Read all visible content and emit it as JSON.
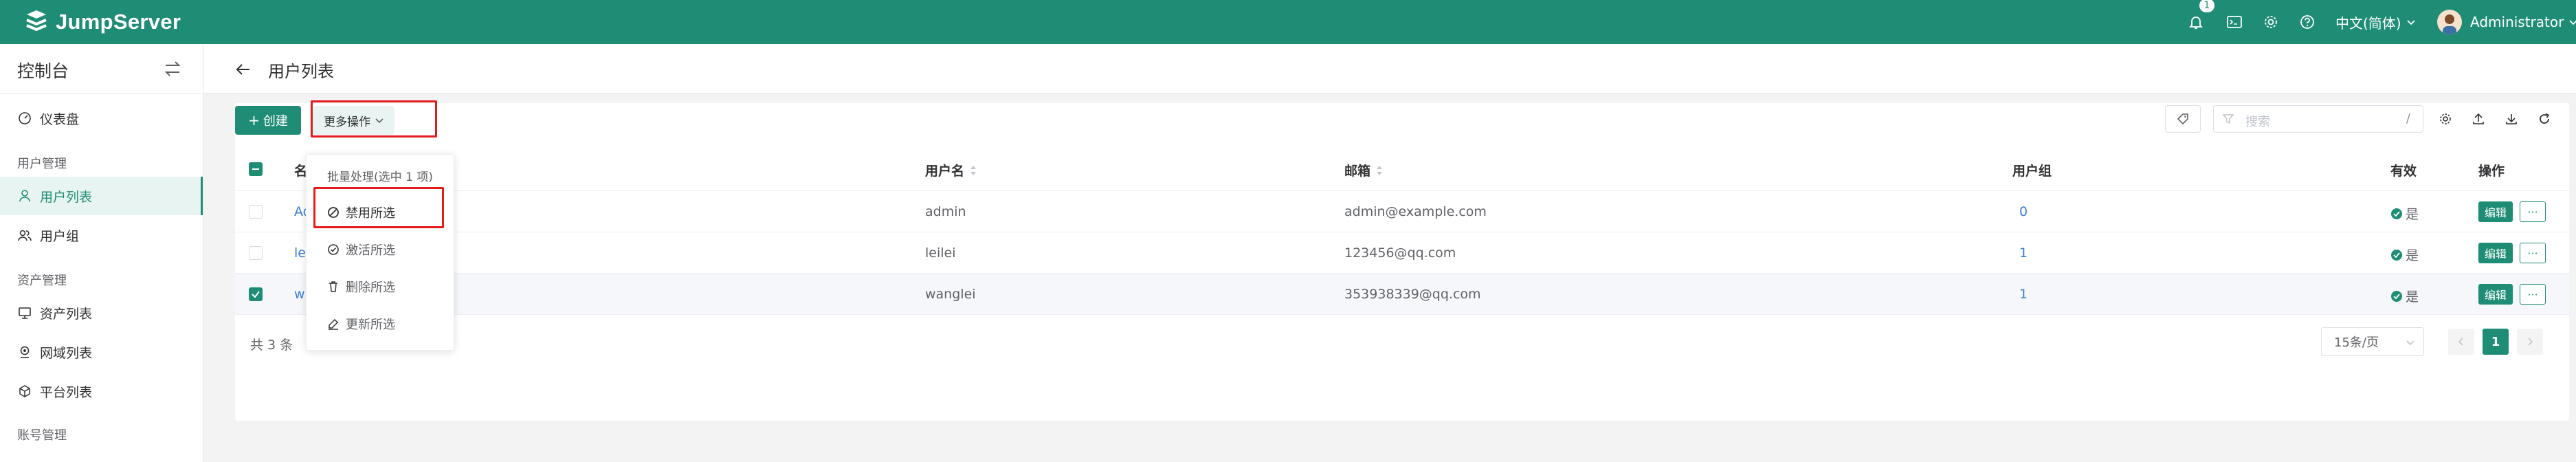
{
  "topbar": {
    "brand": "JumpServer",
    "notification_count": "1",
    "language": "中文(简体)",
    "user": "Administrator",
    "icons": [
      "bell-icon",
      "terminal-icon",
      "gear-icon",
      "help-icon",
      "chevron-down-icon"
    ]
  },
  "sidebar": {
    "title": "控制台",
    "dashboard": "仪表盘",
    "group_user": "用户管理",
    "user_list": "用户列表",
    "user_groups": "用户组",
    "group_asset": "资产管理",
    "asset_list": "资产列表",
    "domain_list": "网域列表",
    "platform_list": "平台列表",
    "group_account": "账号管理"
  },
  "page": {
    "title": "用户列表",
    "create_label": "创建",
    "more_label": "更多操作",
    "search_placeholder": "搜索",
    "search_hint": "/"
  },
  "table": {
    "columns": {
      "name": "名",
      "username": "用户名",
      "email": "邮箱",
      "groups": "用户组",
      "active": "有效",
      "actions": "操作"
    },
    "rows": [
      {
        "name": "Ad",
        "username": "admin",
        "email": "admin@example.com",
        "groups": "0",
        "active": "是",
        "selected": false
      },
      {
        "name": "le",
        "username": "leilei",
        "email": "123456@qq.com",
        "groups": "1",
        "active": "是",
        "selected": false
      },
      {
        "name": "w",
        "username": "wanglei",
        "email": "353938339@qq.com",
        "groups": "1",
        "active": "是",
        "selected": true
      }
    ],
    "edit_label": "编辑",
    "more_label": "···"
  },
  "footer": {
    "total": "共 3 条",
    "page_size": "15条/页",
    "current_page": "1"
  },
  "dropdown": {
    "header": "批量处理(选中 1 项)",
    "disable": "禁用所选",
    "activate": "激活所选",
    "delete": "删除所选",
    "update": "更新所选"
  },
  "colors": {
    "brand": "#1f8d75",
    "highlight": "#e31b1b",
    "link": "#3a7fd5"
  }
}
